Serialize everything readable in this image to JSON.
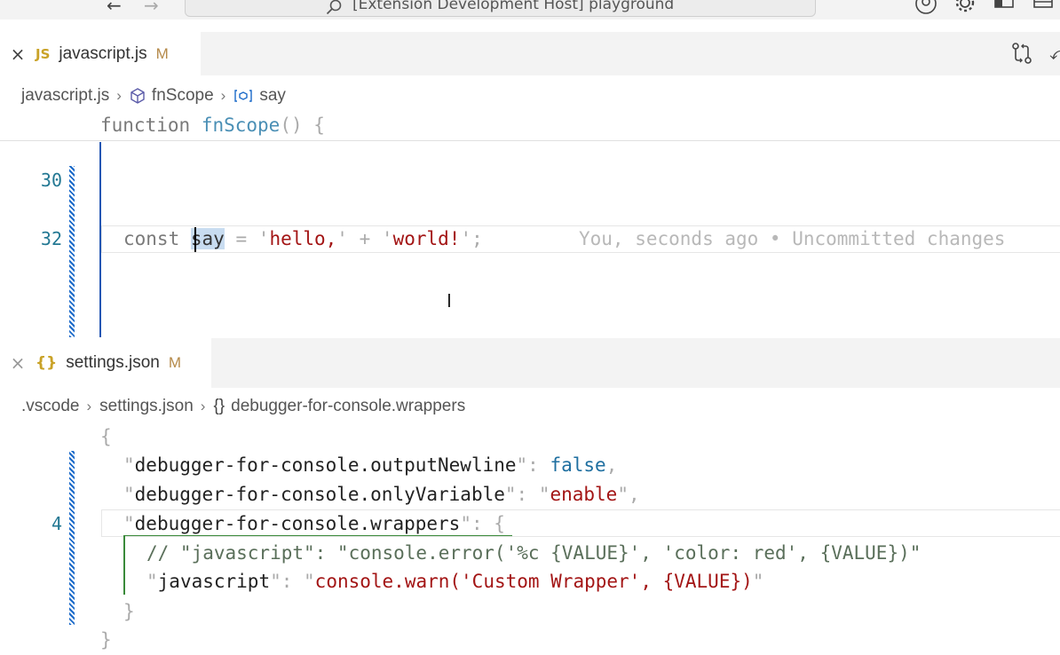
{
  "titlebar": {
    "menu_glyph": "···",
    "back_glyph": "←",
    "forward_glyph": "→",
    "command_center_label": "[Extension Development Host] playground"
  },
  "top_editor": {
    "tab": {
      "close_glyph": "×",
      "icon_text": "JS",
      "label": "javascript.js",
      "modified": "M"
    },
    "breadcrumb": {
      "file": "javascript.js",
      "scope": "fnScope",
      "symbol": "say"
    },
    "sticky_scroll": {
      "keyword": "function",
      "name": "fnScope",
      "parens": "()",
      "brace": "{"
    },
    "lines": [
      {
        "number": "30"
      },
      {
        "number": "32",
        "kw": "const",
        "var": "say",
        "eq": "=",
        "s1q": "'",
        "s1": "hello,",
        "s1qe": "'",
        "plus": "+",
        "s2q": "'",
        "s2": "world!",
        "s2qe": "'",
        "semi": ";",
        "blame": "You, seconds ago • Uncommitted changes"
      }
    ]
  },
  "bottom_editor": {
    "tab": {
      "close_glyph": "×",
      "icon_text": "{}",
      "label": "settings.json",
      "modified": "M"
    },
    "breadcrumb": {
      "folder": ".vscode",
      "file": "settings.json",
      "symbol_icon": "{}",
      "symbol": "debugger-for-console.wrappers"
    },
    "lines": {
      "open_brace": "{",
      "l1_key": "debugger-for-console.outputNewline",
      "l1_value": "false",
      "l2_key": "debugger-for-console.onlyVariable",
      "l2_value": "enable",
      "l3_number": "4",
      "l3_key": "debugger-for-console.wrappers",
      "l3_brace": "{",
      "l4_comment": "// \"javascript\": \"console.error('%c {VALUE}', 'color: red', {VALUE})\"",
      "l5_key": "javascript",
      "l5_value": "console.warn('Custom Wrapper', {VALUE})",
      "close_inner": "}",
      "close_outer": "}"
    }
  },
  "colors": {
    "accent_blue": "#2457b3",
    "modified_badge": "#b58a4a",
    "js_icon": "#c9a227",
    "json_icon": "#c9a227",
    "string": "#a31515",
    "line_number": "#237893"
  },
  "icons": {
    "search": "search-icon",
    "account": "account-icon",
    "settings": "gear-icon",
    "toggle_sidebar": "sidebar-toggle-icon",
    "toggle_panel": "panel-toggle-icon",
    "compare": "git-compare-icon",
    "scope": "cube-icon",
    "variable": "variable-icon"
  }
}
